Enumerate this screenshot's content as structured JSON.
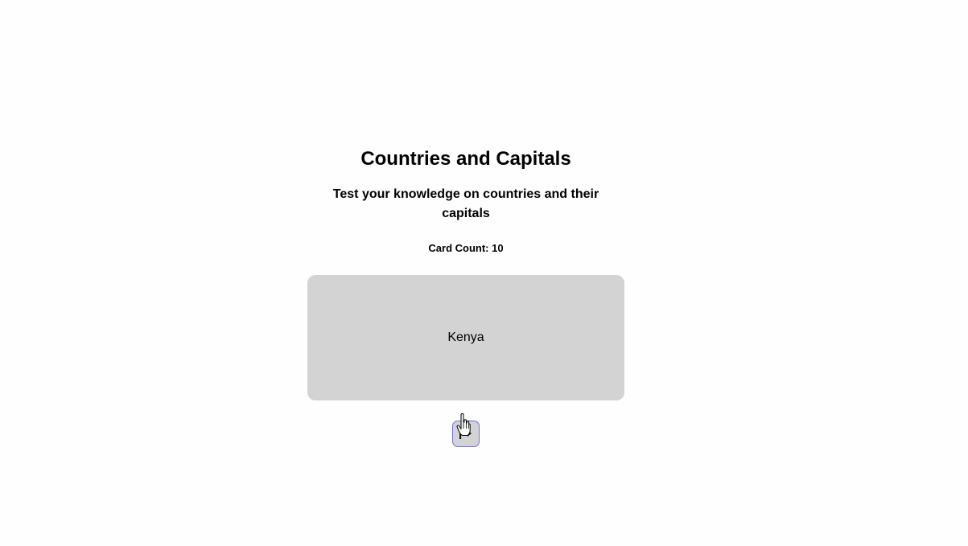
{
  "header": {
    "title": "Countries and Capitals",
    "subtitle": "Test your knowledge on countries and their capitals",
    "card_count": "Card Count: 10"
  },
  "card": {
    "text": "Kenya"
  },
  "controls": {
    "next_icon": "arrow-right-icon",
    "cursor_icon": "hand-pointer-icon"
  },
  "colors": {
    "card_background": "#d3d3d3",
    "button_border": "#6e6ef0"
  }
}
